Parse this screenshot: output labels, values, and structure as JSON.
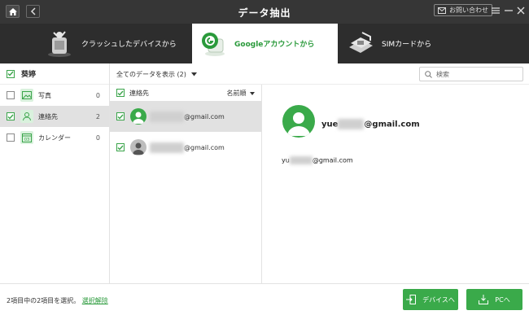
{
  "window": {
    "title": "データ抽出",
    "contact_label": "お問い合わせ"
  },
  "tabs": [
    {
      "label": "クラッシュしたデバイスから",
      "active": false,
      "icon": "crashed-phone-icon"
    },
    {
      "label": "Googleアカウントから",
      "active": true,
      "icon": "google-account-icon"
    },
    {
      "label": "SIMカードから",
      "active": false,
      "icon": "sim-card-icon"
    }
  ],
  "sidebar": {
    "header": "葵婷",
    "items": [
      {
        "label": "写真",
        "count": "0",
        "checked": false,
        "selected": false,
        "icon": "photo-icon"
      },
      {
        "label": "連絡先",
        "count": "2",
        "checked": true,
        "selected": true,
        "icon": "contact-icon"
      },
      {
        "label": "カレンダー",
        "count": "0",
        "checked": false,
        "selected": false,
        "icon": "calendar-icon"
      }
    ]
  },
  "toolbar": {
    "filter_label": "全てのデータを表示 (2)",
    "search_placeholder": "検索"
  },
  "list": {
    "header": "連絡先",
    "sort_label": "名前順",
    "rows": [
      {
        "email_suffix": "@gmail.com",
        "checked": true,
        "selected": true
      },
      {
        "email_suffix": "@gmail.com",
        "checked": true,
        "selected": false
      }
    ]
  },
  "detail": {
    "name_prefix": "yue",
    "name_suffix": "@gmail.com",
    "email_prefix": "yu",
    "email_suffix": "@gmail.com"
  },
  "footer": {
    "status": "2項目中の2項目を選択。",
    "deselect_link": "選択解除",
    "to_device": "デバイスへ",
    "to_pc": "PCへ"
  },
  "colors": {
    "accent": "#3aaa4a",
    "topbar": "#363636",
    "tabbar": "#2d2d2d",
    "selected_row": "#e1e1e1"
  }
}
